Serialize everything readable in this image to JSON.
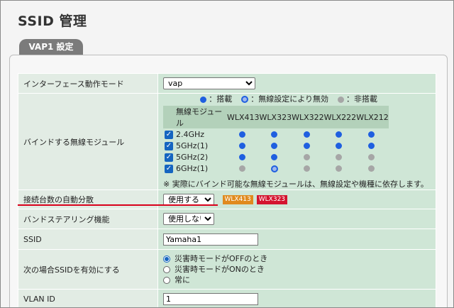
{
  "page_title": "SSID 管理",
  "tab_label": "VAP1 設定",
  "rows": {
    "interface_mode": {
      "label": "インターフェース動作モード",
      "value": "vap"
    },
    "bind_modules": {
      "label": "バインドする無線モジュール",
      "legend": {
        "mounted": "：搭載",
        "disabled_by_setting": "：無線設定により無効",
        "not_mounted": "：非搭載"
      },
      "header_module": "無線モジュール",
      "models": [
        "WLX413",
        "WLX323",
        "WLX322",
        "WLX222",
        "WLX212"
      ],
      "bands": [
        {
          "name": "2.4GHz",
          "checked": true,
          "states": [
            "on",
            "on",
            "on",
            "on",
            "on"
          ]
        },
        {
          "name": "5GHz(1)",
          "checked": true,
          "states": [
            "on",
            "on",
            "on",
            "on",
            "on"
          ]
        },
        {
          "name": "5GHz(2)",
          "checked": true,
          "states": [
            "on",
            "on",
            "off",
            "off",
            "off"
          ]
        },
        {
          "name": "6GHz(1)",
          "checked": true,
          "states": [
            "off",
            "ring",
            "off",
            "off",
            "off"
          ]
        }
      ],
      "note": "※ 実際にバインド可能な無線モジュールは、無線設定や機種に依存します。"
    },
    "auto_distribute": {
      "label": "接続台数の自動分散",
      "value": "使用する",
      "badges": [
        {
          "text": "WLX413",
          "color": "#e08a1e"
        },
        {
          "text": "WLX323",
          "color": "#d4142f"
        }
      ]
    },
    "band_steering": {
      "label": "バンドステアリング機能",
      "value": "使用しない"
    },
    "ssid": {
      "label": "SSID",
      "value": "Yamaha1"
    },
    "ssid_enable": {
      "label": "次の場合SSIDを有効にする",
      "options": [
        "災害時モードがOFFのとき",
        "災害時モードがONのとき",
        "常に"
      ],
      "selected": 0
    },
    "vlan_id": {
      "label": "VLAN ID",
      "value": "1"
    }
  }
}
